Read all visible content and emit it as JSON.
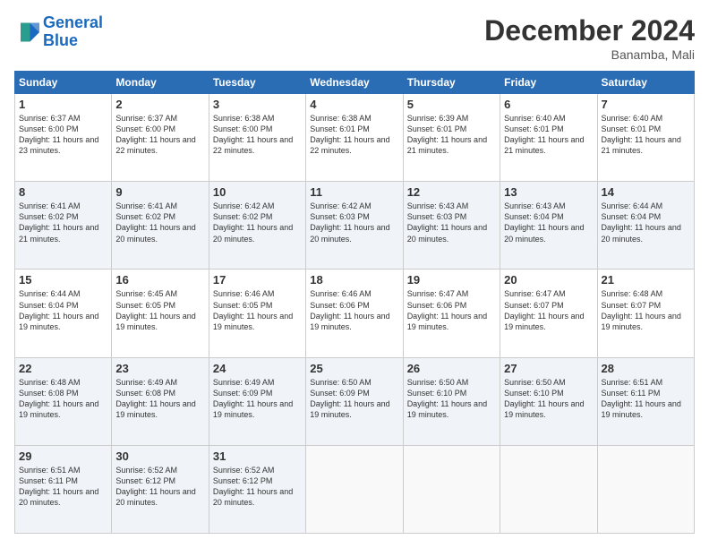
{
  "logo": {
    "line1": "General",
    "line2": "Blue"
  },
  "header": {
    "month": "December 2024",
    "location": "Banamba, Mali"
  },
  "days_of_week": [
    "Sunday",
    "Monday",
    "Tuesday",
    "Wednesday",
    "Thursday",
    "Friday",
    "Saturday"
  ],
  "weeks": [
    [
      {
        "day": 1,
        "sunrise": "6:37 AM",
        "sunset": "6:00 PM",
        "daylight": "11 hours and 23 minutes"
      },
      {
        "day": 2,
        "sunrise": "6:37 AM",
        "sunset": "6:00 PM",
        "daylight": "11 hours and 22 minutes"
      },
      {
        "day": 3,
        "sunrise": "6:38 AM",
        "sunset": "6:00 PM",
        "daylight": "11 hours and 22 minutes"
      },
      {
        "day": 4,
        "sunrise": "6:38 AM",
        "sunset": "6:01 PM",
        "daylight": "11 hours and 22 minutes"
      },
      {
        "day": 5,
        "sunrise": "6:39 AM",
        "sunset": "6:01 PM",
        "daylight": "11 hours and 21 minutes"
      },
      {
        "day": 6,
        "sunrise": "6:40 AM",
        "sunset": "6:01 PM",
        "daylight": "11 hours and 21 minutes"
      },
      {
        "day": 7,
        "sunrise": "6:40 AM",
        "sunset": "6:01 PM",
        "daylight": "11 hours and 21 minutes"
      }
    ],
    [
      {
        "day": 8,
        "sunrise": "6:41 AM",
        "sunset": "6:02 PM",
        "daylight": "11 hours and 21 minutes"
      },
      {
        "day": 9,
        "sunrise": "6:41 AM",
        "sunset": "6:02 PM",
        "daylight": "11 hours and 20 minutes"
      },
      {
        "day": 10,
        "sunrise": "6:42 AM",
        "sunset": "6:02 PM",
        "daylight": "11 hours and 20 minutes"
      },
      {
        "day": 11,
        "sunrise": "6:42 AM",
        "sunset": "6:03 PM",
        "daylight": "11 hours and 20 minutes"
      },
      {
        "day": 12,
        "sunrise": "6:43 AM",
        "sunset": "6:03 PM",
        "daylight": "11 hours and 20 minutes"
      },
      {
        "day": 13,
        "sunrise": "6:43 AM",
        "sunset": "6:04 PM",
        "daylight": "11 hours and 20 minutes"
      },
      {
        "day": 14,
        "sunrise": "6:44 AM",
        "sunset": "6:04 PM",
        "daylight": "11 hours and 20 minutes"
      }
    ],
    [
      {
        "day": 15,
        "sunrise": "6:44 AM",
        "sunset": "6:04 PM",
        "daylight": "11 hours and 19 minutes"
      },
      {
        "day": 16,
        "sunrise": "6:45 AM",
        "sunset": "6:05 PM",
        "daylight": "11 hours and 19 minutes"
      },
      {
        "day": 17,
        "sunrise": "6:46 AM",
        "sunset": "6:05 PM",
        "daylight": "11 hours and 19 minutes"
      },
      {
        "day": 18,
        "sunrise": "6:46 AM",
        "sunset": "6:06 PM",
        "daylight": "11 hours and 19 minutes"
      },
      {
        "day": 19,
        "sunrise": "6:47 AM",
        "sunset": "6:06 PM",
        "daylight": "11 hours and 19 minutes"
      },
      {
        "day": 20,
        "sunrise": "6:47 AM",
        "sunset": "6:07 PM",
        "daylight": "11 hours and 19 minutes"
      },
      {
        "day": 21,
        "sunrise": "6:48 AM",
        "sunset": "6:07 PM",
        "daylight": "11 hours and 19 minutes"
      }
    ],
    [
      {
        "day": 22,
        "sunrise": "6:48 AM",
        "sunset": "6:08 PM",
        "daylight": "11 hours and 19 minutes"
      },
      {
        "day": 23,
        "sunrise": "6:49 AM",
        "sunset": "6:08 PM",
        "daylight": "11 hours and 19 minutes"
      },
      {
        "day": 24,
        "sunrise": "6:49 AM",
        "sunset": "6:09 PM",
        "daylight": "11 hours and 19 minutes"
      },
      {
        "day": 25,
        "sunrise": "6:50 AM",
        "sunset": "6:09 PM",
        "daylight": "11 hours and 19 minutes"
      },
      {
        "day": 26,
        "sunrise": "6:50 AM",
        "sunset": "6:10 PM",
        "daylight": "11 hours and 19 minutes"
      },
      {
        "day": 27,
        "sunrise": "6:50 AM",
        "sunset": "6:10 PM",
        "daylight": "11 hours and 19 minutes"
      },
      {
        "day": 28,
        "sunrise": "6:51 AM",
        "sunset": "6:11 PM",
        "daylight": "11 hours and 19 minutes"
      }
    ],
    [
      {
        "day": 29,
        "sunrise": "6:51 AM",
        "sunset": "6:11 PM",
        "daylight": "11 hours and 20 minutes"
      },
      {
        "day": 30,
        "sunrise": "6:52 AM",
        "sunset": "6:12 PM",
        "daylight": "11 hours and 20 minutes"
      },
      {
        "day": 31,
        "sunrise": "6:52 AM",
        "sunset": "6:12 PM",
        "daylight": "11 hours and 20 minutes"
      },
      null,
      null,
      null,
      null
    ]
  ]
}
